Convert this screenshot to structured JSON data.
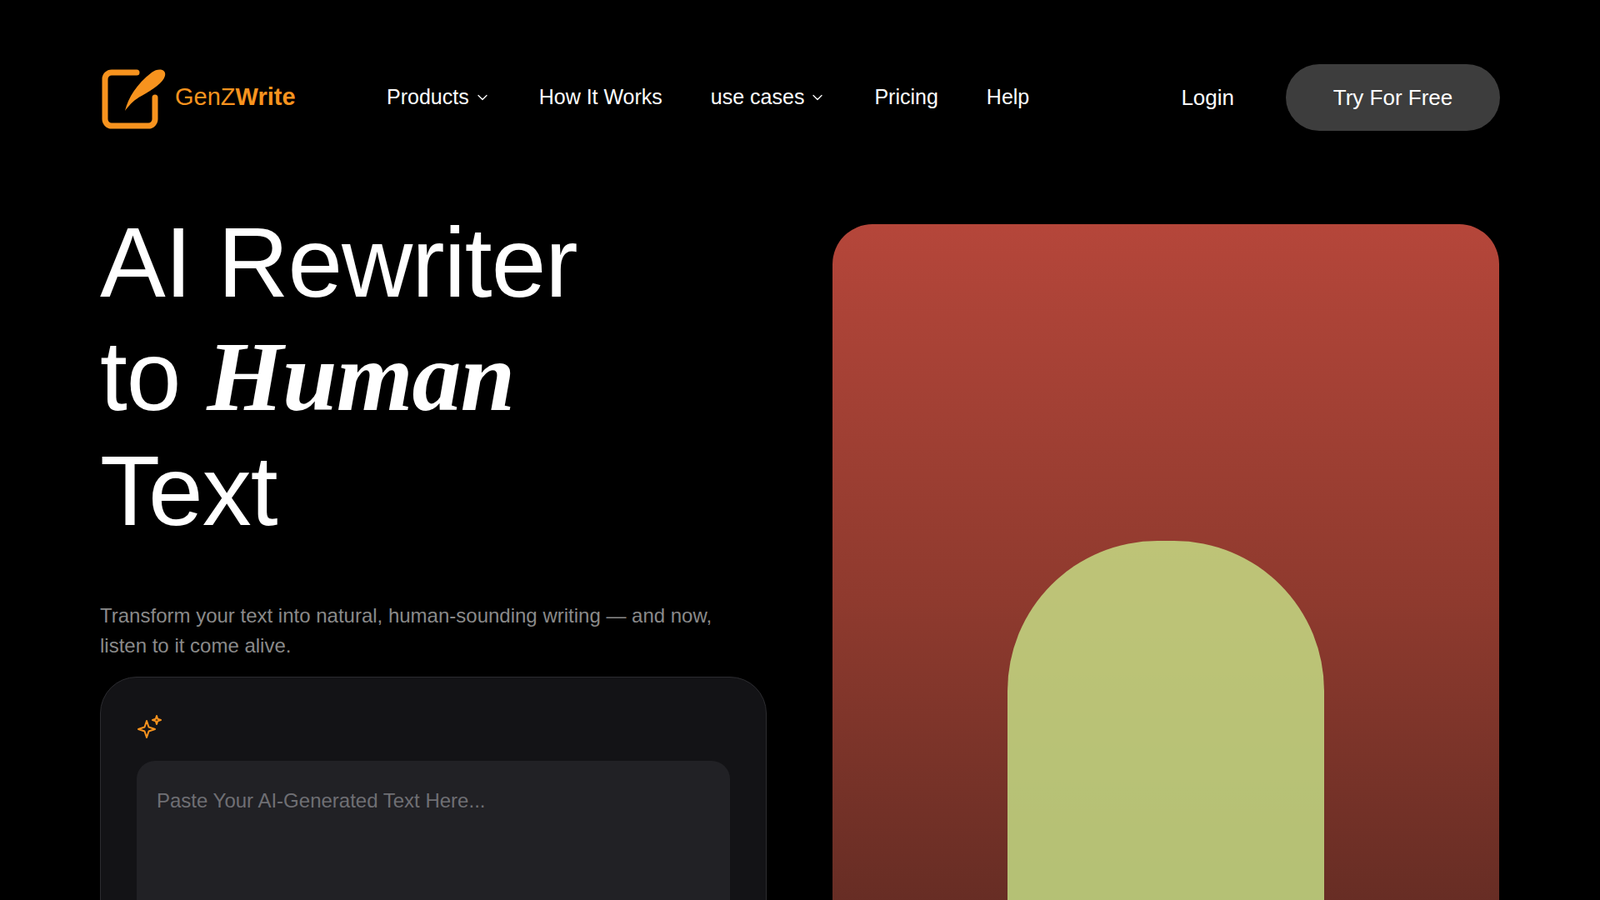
{
  "brand": {
    "name_light": "GenZ",
    "name_bold": "Write"
  },
  "nav": {
    "links": [
      {
        "label": "Products",
        "has_menu": true
      },
      {
        "label": "How It Works",
        "has_menu": false
      },
      {
        "label": "use cases",
        "has_menu": true
      },
      {
        "label": "Pricing",
        "has_menu": false
      },
      {
        "label": "Help",
        "has_menu": false
      }
    ],
    "login": "Login",
    "cta": "Try For Free"
  },
  "hero": {
    "line1": "AI Rewriter",
    "line2_plain": "to",
    "line2_accent": "Human",
    "line3": "Text",
    "subtitle": "Transform your text into natural, human-sounding writing — and now, listen to it come alive."
  },
  "input": {
    "placeholder": "Paste Your AI-Generated Text Here..."
  }
}
